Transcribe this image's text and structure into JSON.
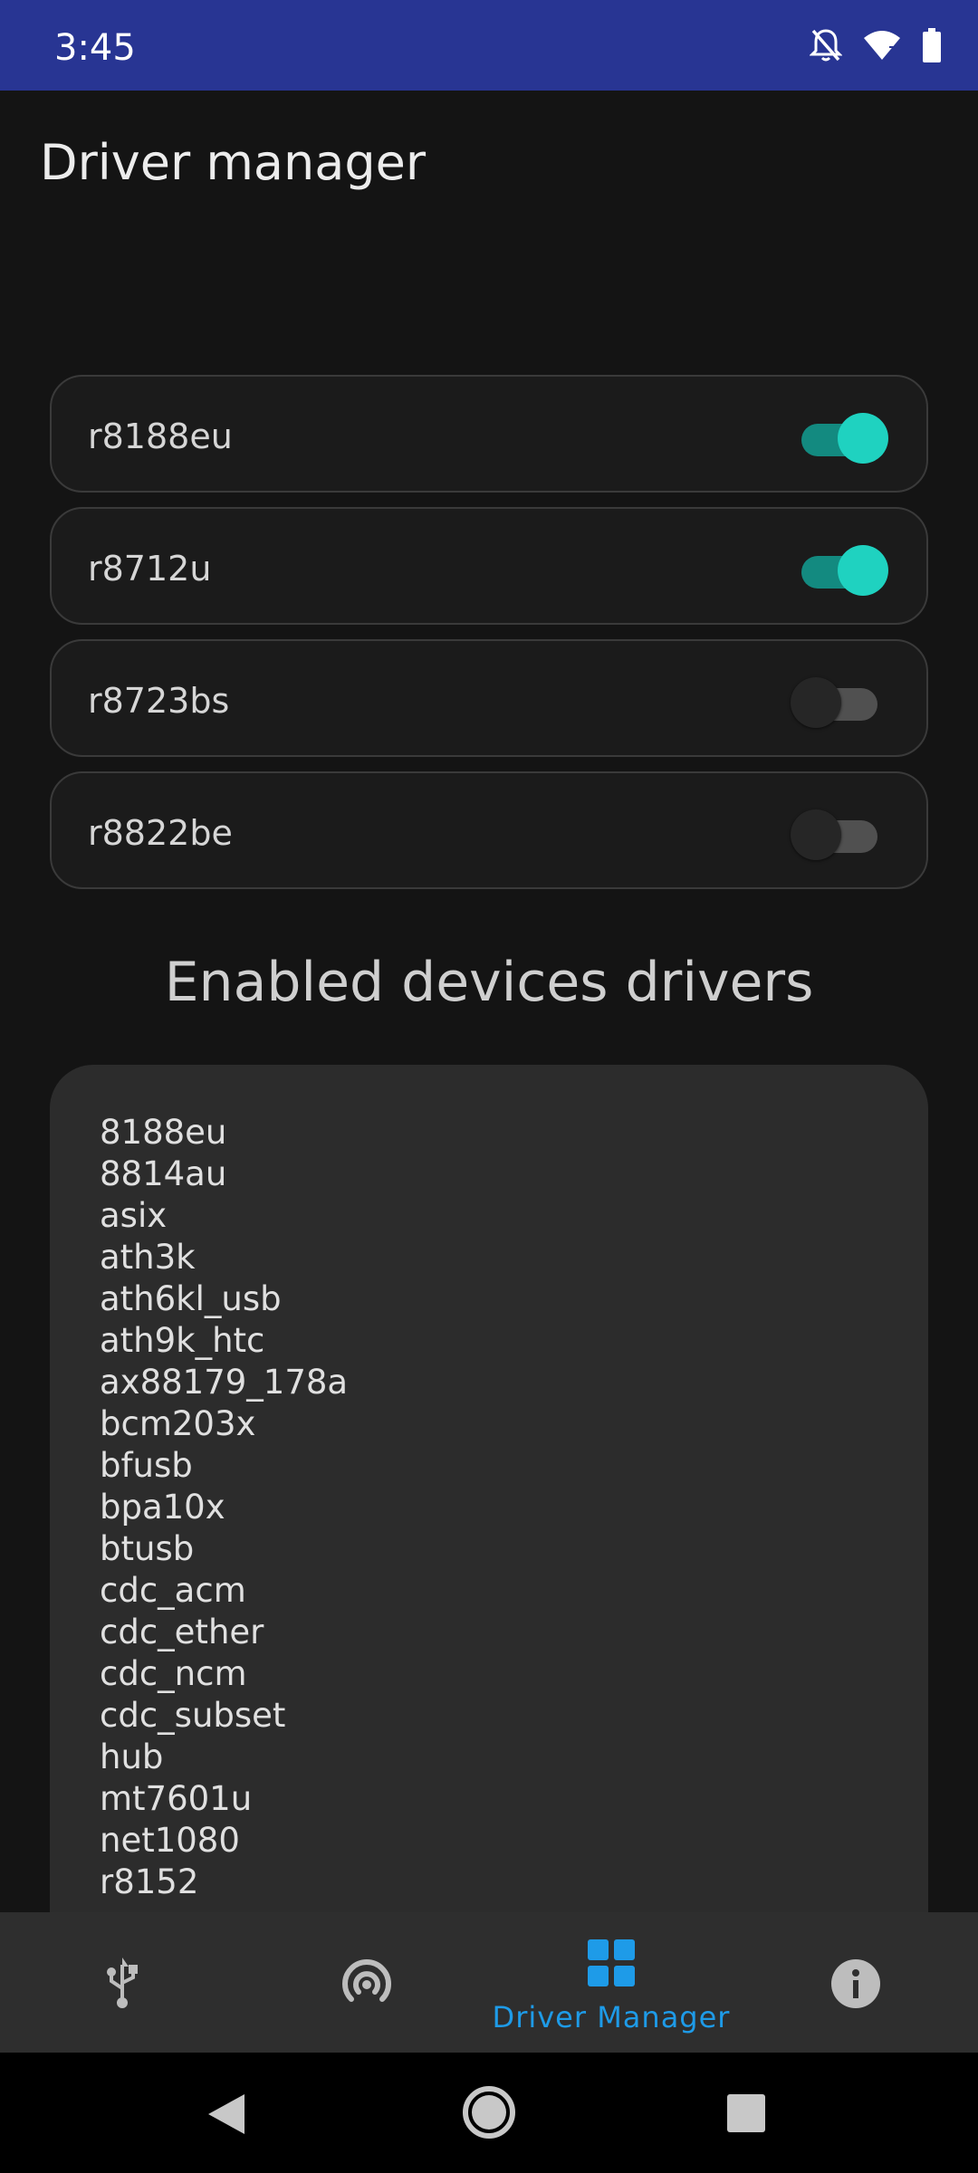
{
  "status_bar": {
    "time": "3:45",
    "icons": [
      "notifications-off-icon",
      "wifi-icon",
      "battery-icon"
    ]
  },
  "page_title": "Driver manager",
  "drivers": [
    {
      "name": "r8188eu",
      "enabled": true
    },
    {
      "name": "r8712u",
      "enabled": true
    },
    {
      "name": "r8723bs",
      "enabled": false
    },
    {
      "name": "r8822be",
      "enabled": false
    }
  ],
  "enabled_section": {
    "heading": "Enabled devices drivers",
    "items": [
      "8188eu",
      "8814au",
      "asix",
      "ath3k",
      "ath6kl_usb",
      "ath9k_htc",
      "ax88179_178a",
      "bcm203x",
      "bfusb",
      "bpa10x",
      "btusb",
      "cdc_acm",
      "cdc_ether",
      "cdc_ncm",
      "cdc_subset",
      "hub",
      "mt7601u",
      "net1080",
      "r8152"
    ]
  },
  "bottom_nav": {
    "items": [
      {
        "icon": "usb-icon",
        "label": "",
        "active": false
      },
      {
        "icon": "broadcast-icon",
        "label": "",
        "active": false
      },
      {
        "icon": "dashboard-icon",
        "label": "Driver Manager",
        "active": true
      },
      {
        "icon": "info-icon",
        "label": "",
        "active": false
      }
    ]
  },
  "system_nav": [
    "back-icon",
    "home-icon",
    "recents-icon"
  ],
  "colors": {
    "status_bar": "#283593",
    "accent": "#1fd2c0",
    "nav_active": "#1e9be8",
    "background": "#141414"
  }
}
